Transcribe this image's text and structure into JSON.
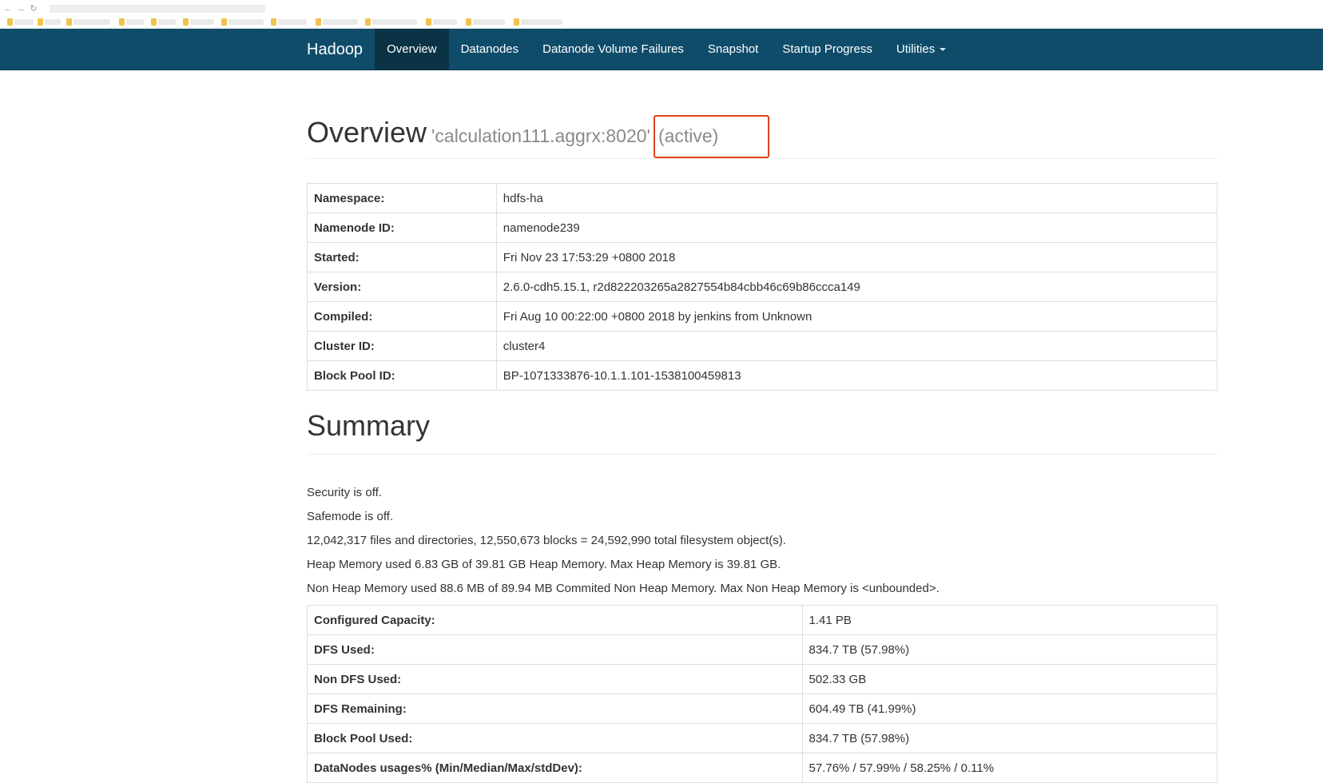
{
  "navbar": {
    "brand": "Hadoop",
    "items": [
      {
        "label": "Overview",
        "active": true
      },
      {
        "label": "Datanodes"
      },
      {
        "label": "Datanode Volume Failures"
      },
      {
        "label": "Snapshot"
      },
      {
        "label": "Startup Progress"
      },
      {
        "label": "Utilities",
        "dropdown": true
      }
    ]
  },
  "overview": {
    "title": "Overview",
    "host": "'calculation111.aggrx:8020'",
    "state": "(active)",
    "rows": [
      {
        "key": "Namespace:",
        "value": "hdfs-ha"
      },
      {
        "key": "Namenode ID:",
        "value": "namenode239"
      },
      {
        "key": "Started:",
        "value": "Fri Nov 23 17:53:29 +0800 2018"
      },
      {
        "key": "Version:",
        "value": "2.6.0-cdh5.15.1, r2d822203265a2827554b84cbb46c69b86ccca149"
      },
      {
        "key": "Compiled:",
        "value": "Fri Aug 10 00:22:00 +0800 2018 by jenkins from Unknown"
      },
      {
        "key": "Cluster ID:",
        "value": "cluster4"
      },
      {
        "key": "Block Pool ID:",
        "value": "BP-1071333876-10.1.1.101-1538100459813"
      }
    ]
  },
  "summary": {
    "title": "Summary",
    "lines": [
      "Security is off.",
      "Safemode is off.",
      "12,042,317 files and directories, 12,550,673 blocks = 24,592,990 total filesystem object(s).",
      "Heap Memory used 6.83 GB of 39.81 GB Heap Memory. Max Heap Memory is 39.81 GB.",
      "Non Heap Memory used 88.6 MB of 89.94 MB Commited Non Heap Memory. Max Non Heap Memory is <unbounded>."
    ],
    "rows": [
      {
        "key": "Configured Capacity:",
        "value": "1.41 PB"
      },
      {
        "key": "DFS Used:",
        "value": "834.7 TB (57.98%)"
      },
      {
        "key": "Non DFS Used:",
        "value": "502.33 GB"
      },
      {
        "key": "DFS Remaining:",
        "value": "604.49 TB (41.99%)"
      },
      {
        "key": "Block Pool Used:",
        "value": "834.7 TB (57.98%)"
      },
      {
        "key": "DataNodes usages% (Min/Median/Max/stdDev):",
        "value": "57.76% / 57.99% / 58.25% / 0.11%"
      }
    ]
  },
  "colors": {
    "navbar_bg": "#0f4c6a",
    "navbar_active_bg": "#0a3346",
    "highlight_border": "#e2401d"
  }
}
